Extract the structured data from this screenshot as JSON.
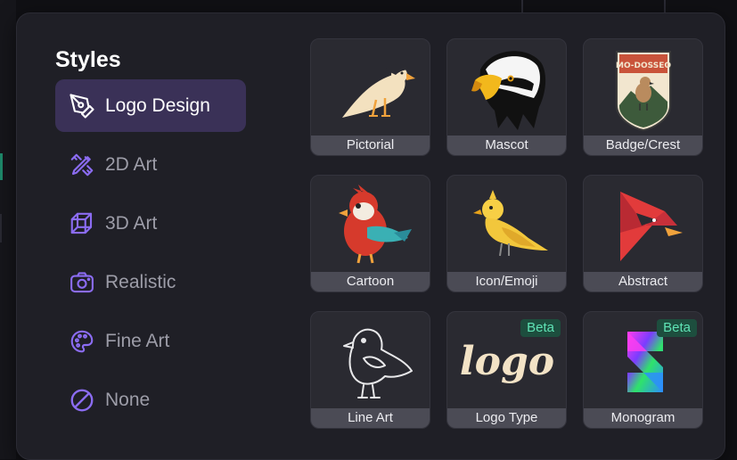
{
  "panel": {
    "title": "Styles"
  },
  "menu": [
    {
      "label": "Logo Design",
      "icon": "pen-nib-icon",
      "active": true
    },
    {
      "label": "2D Art",
      "icon": "pencil-ruler-icon",
      "active": false
    },
    {
      "label": "3D Art",
      "icon": "cube-icon",
      "active": false
    },
    {
      "label": "Realistic",
      "icon": "camera-icon",
      "active": false
    },
    {
      "label": "Fine Art",
      "icon": "palette-icon",
      "active": false
    },
    {
      "label": "None",
      "icon": "ban-icon",
      "active": false
    }
  ],
  "styles": [
    {
      "label": "Pictorial",
      "badge": ""
    },
    {
      "label": "Mascot",
      "badge": ""
    },
    {
      "label": "Badge/Crest",
      "badge": "",
      "badge_text": "MO-DOSSEO"
    },
    {
      "label": "Cartoon",
      "badge": ""
    },
    {
      "label": "Icon/Emoji",
      "badge": ""
    },
    {
      "label": "Abstract",
      "badge": ""
    },
    {
      "label": "Line Art",
      "badge": ""
    },
    {
      "label": "Logo Type",
      "badge": "Beta",
      "thumb_text": "logo"
    },
    {
      "label": "Monogram",
      "badge": "Beta"
    }
  ],
  "colors": {
    "accent": "#8b6cf2",
    "active_bg": "#3a3157",
    "beta_text": "#5fe3b5",
    "beta_bg": "#1d4e3e"
  }
}
